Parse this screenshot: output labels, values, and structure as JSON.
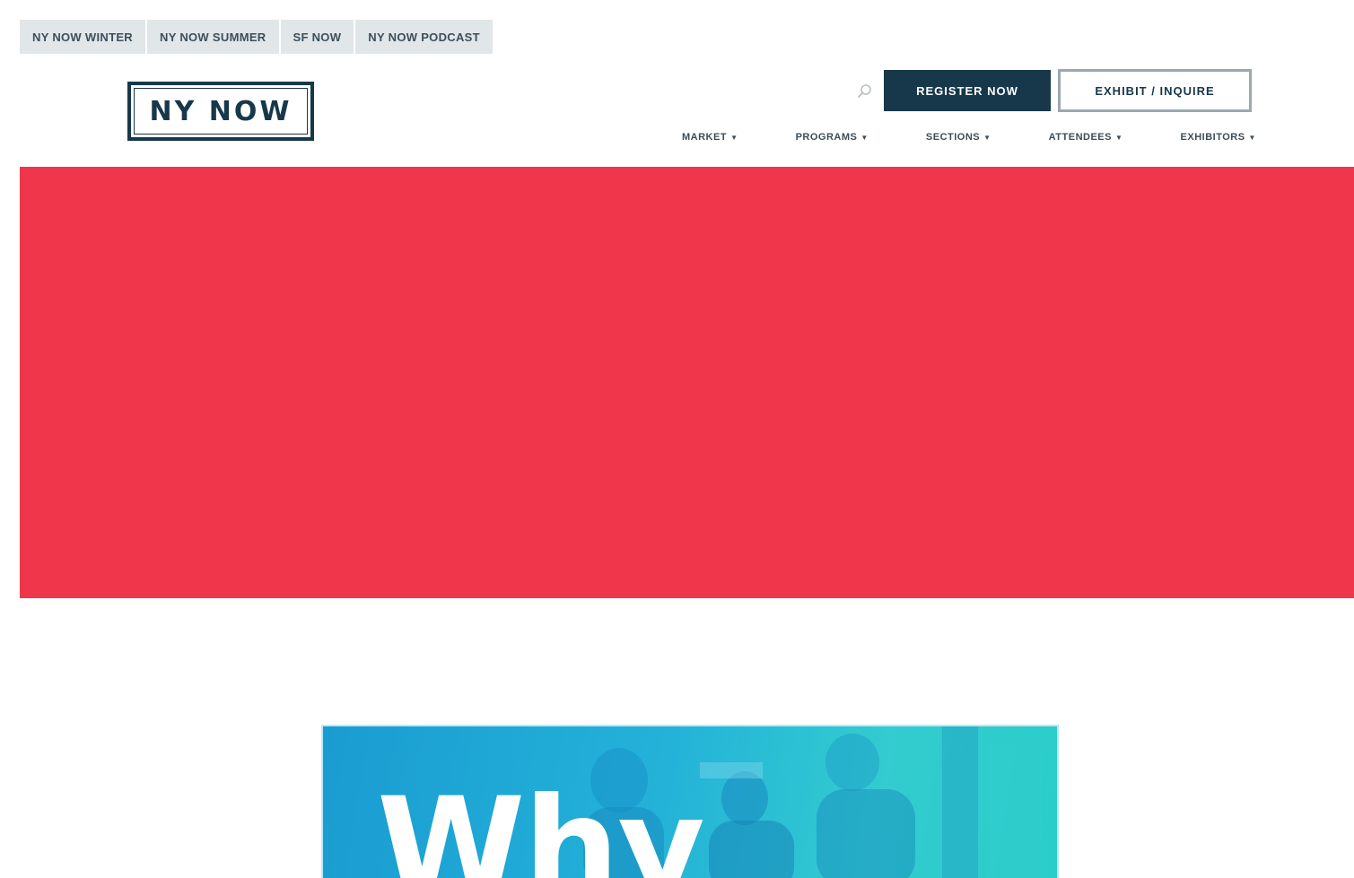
{
  "site_tabs": [
    {
      "label": "NY NOW WINTER"
    },
    {
      "label": "NY NOW SUMMER"
    },
    {
      "label": "SF NOW"
    },
    {
      "label": "NY NOW PODCAST"
    }
  ],
  "header": {
    "logo_text": "NY NOW",
    "search_icon": "search-icon",
    "register_label": "REGISTER NOW",
    "exhibit_label": "EXHIBIT / INQUIRE"
  },
  "nav": {
    "items": [
      {
        "label": "MARKET"
      },
      {
        "label": "PROGRAMS"
      },
      {
        "label": "SECTIONS"
      },
      {
        "label": "ATTENDEES"
      },
      {
        "label": "EXHIBITORS"
      }
    ],
    "dropdown_icon": "chevron-down-icon"
  },
  "promo": {
    "heading": "Why"
  },
  "colors": {
    "brand_navy": "#17384a",
    "hero_red": "#f0364a",
    "tab_bar": "#e1e6e8",
    "promo_cyan": "#24b6e0"
  }
}
